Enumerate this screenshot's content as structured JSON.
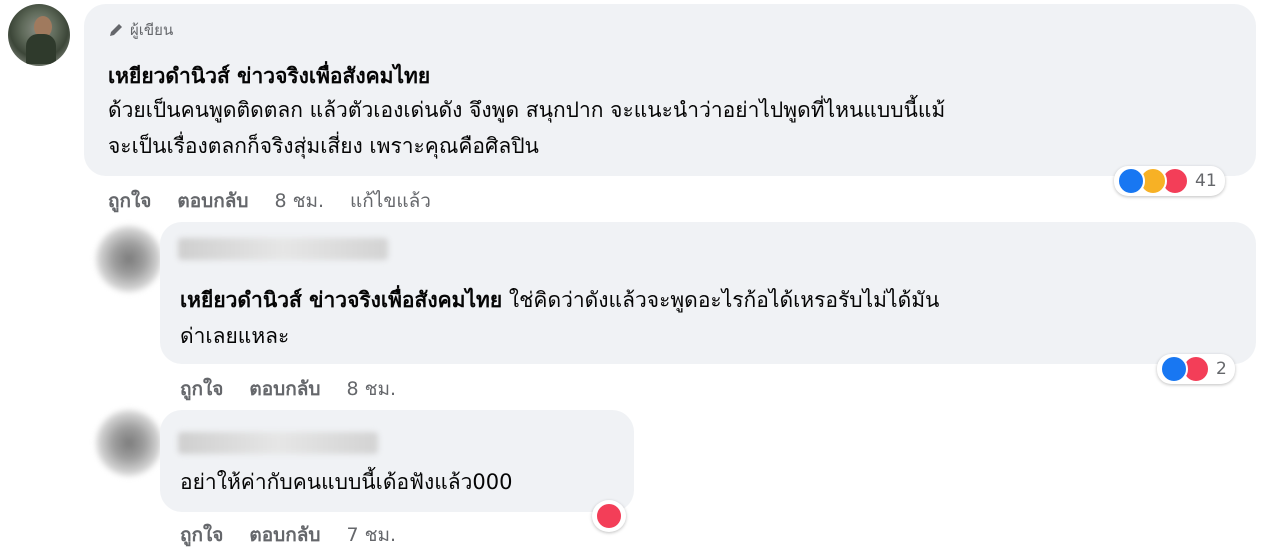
{
  "comment1": {
    "author_badge": "ผู้เขียน",
    "name": "เหยียวดำนิวส์ ข่าวจริงเพื่อสังคมไทย",
    "text_line1": "ด้วยเป็นคนพูดติดตลก แล้วตัวเองเด่นดัง จึงพูด สนุกปาก จะแนะนำว่าอย่าไปพูดที่ไหนแบบนี้แม้",
    "text_line2": "จะเป็นเรื่องตลกก็จริงสุ่มเสี่ยง เพราะคุณคือศิลปิน",
    "like_label": "ถูกใจ",
    "reply_label": "ตอบกลับ",
    "time": "8 ชม.",
    "edited": "แก้ไขแล้ว",
    "reaction_count": "41",
    "reactions": [
      "like-icon",
      "haha-icon",
      "love-icon"
    ]
  },
  "reply1": {
    "tag": "เหยียวดำนิวส์ ข่าวจริงเพื่อสังคมไทย",
    "text_line1": " ใช่คิดว่าดังแล้วจะพูดอะไรก้อได้เหรอรับไม่ได้มัน",
    "text_line2": "ด่าเลยแหละ",
    "like_label": "ถูกใจ",
    "reply_label": "ตอบกลับ",
    "time": "8 ชม.",
    "reaction_count": "2",
    "reactions": [
      "like-icon",
      "love-icon"
    ]
  },
  "reply2": {
    "text": "อย่าให้ค่ากับคนแบบนี้เด้อฟังแล้ว000",
    "like_label": "ถูกใจ",
    "reply_label": "ตอบกลับ",
    "time": "7 ชม.",
    "reactions": [
      "love-icon"
    ]
  },
  "colors": {
    "bubble": "#f0f2f5",
    "meta": "#65676b",
    "like": "#1877f2",
    "haha": "#f7b125",
    "love": "#f33e58"
  }
}
